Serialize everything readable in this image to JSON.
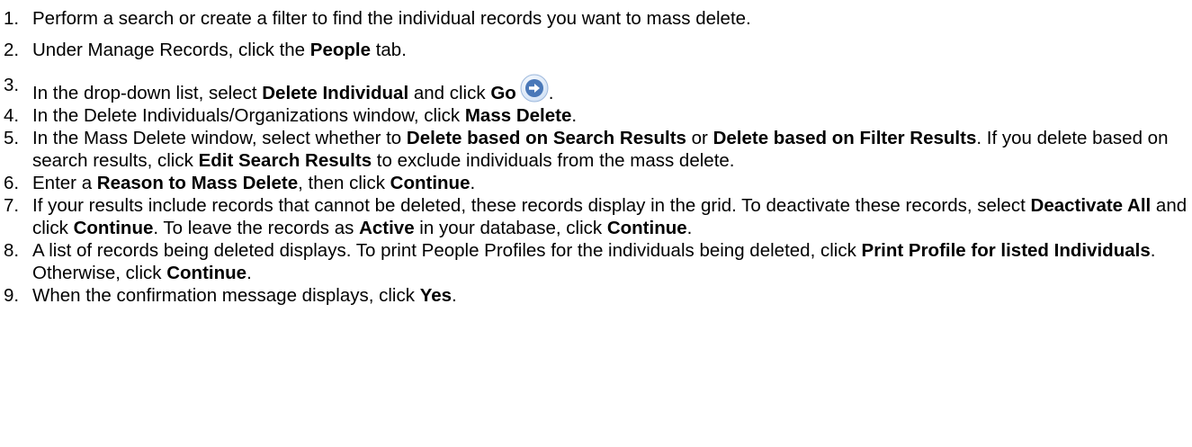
{
  "steps": [
    {
      "number": "1.",
      "parts": [
        {
          "text": "Perform a search or create a filter to find the individual records you want to mass delete.",
          "bold": false
        }
      ]
    },
    {
      "number": "2.",
      "parts": [
        {
          "text": "Under Manage Records, click the ",
          "bold": false
        },
        {
          "text": "People",
          "bold": true
        },
        {
          "text": " tab.",
          "bold": false
        }
      ]
    },
    {
      "number": "3.",
      "parts": [
        {
          "text": "In the drop-down list, select ",
          "bold": false
        },
        {
          "text": "Delete Individual",
          "bold": true
        },
        {
          "text": " and click ",
          "bold": false
        },
        {
          "text": "Go",
          "bold": true
        },
        {
          "icon": "go-arrow-icon"
        },
        {
          "text": ".",
          "bold": false
        }
      ]
    },
    {
      "number": "4.",
      "parts": [
        {
          "text": "In the Delete Individuals/Organizations window, click ",
          "bold": false
        },
        {
          "text": "Mass Delete",
          "bold": true
        },
        {
          "text": ".",
          "bold": false
        }
      ]
    },
    {
      "number": "5.",
      "parts": [
        {
          "text": "In the Mass Delete window, select whether to ",
          "bold": false
        },
        {
          "text": "Delete based on Search Results",
          "bold": true
        },
        {
          "text": " or ",
          "bold": false
        },
        {
          "text": "Delete based on Filter Results",
          "bold": true
        },
        {
          "text": ". If you delete based on search results, click ",
          "bold": false
        },
        {
          "text": "Edit Search Results",
          "bold": true
        },
        {
          "text": " to exclude individuals from the mass delete.",
          "bold": false
        }
      ]
    },
    {
      "number": "6.",
      "parts": [
        {
          "text": "Enter a ",
          "bold": false
        },
        {
          "text": "Reason to Mass Delete",
          "bold": true
        },
        {
          "text": ", then click ",
          "bold": false
        },
        {
          "text": "Continue",
          "bold": true
        },
        {
          "text": ".",
          "bold": false
        }
      ]
    },
    {
      "number": "7.",
      "parts": [
        {
          "text": "If your results include records that cannot be deleted, these records display in the grid. To deactivate these records, select ",
          "bold": false
        },
        {
          "text": "Deactivate All",
          "bold": true
        },
        {
          "text": " and click ",
          "bold": false
        },
        {
          "text": "Continue",
          "bold": true
        },
        {
          "text": ". To leave the records as ",
          "bold": false
        },
        {
          "text": "Active",
          "bold": true
        },
        {
          "text": " in your database, click ",
          "bold": false
        },
        {
          "text": "Continue",
          "bold": true
        },
        {
          "text": ".",
          "bold": false
        }
      ]
    },
    {
      "number": "8.",
      "parts": [
        {
          "text": "A list of records being deleted displays. To print People Profiles for the individuals being deleted, click ",
          "bold": false
        },
        {
          "text": "Print Profile for listed Individuals",
          "bold": true
        },
        {
          "text": ". Otherwise, click ",
          "bold": false
        },
        {
          "text": "Continue",
          "bold": true
        },
        {
          "text": ".",
          "bold": false
        }
      ]
    },
    {
      "number": "9.",
      "parts": [
        {
          "text": "When the confirmation message displays, click ",
          "bold": false
        },
        {
          "text": "Yes",
          "bold": true
        },
        {
          "text": ".",
          "bold": false
        }
      ]
    }
  ],
  "colors": {
    "text": "#000000",
    "background": "#ffffff",
    "go_icon_fill": "#4a78b8",
    "go_icon_ring": "#cfe0f5"
  }
}
